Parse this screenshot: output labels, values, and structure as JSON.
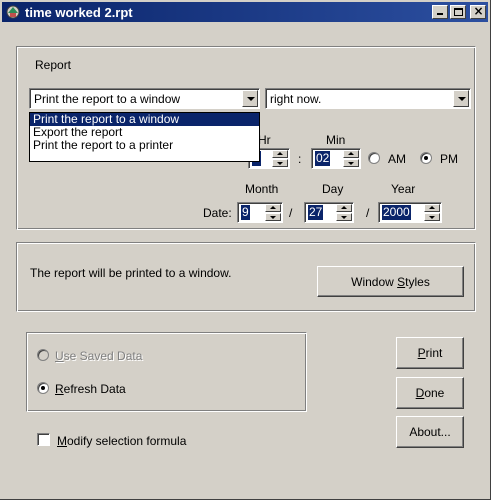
{
  "window": {
    "title": "time worked 2.rpt"
  },
  "report": {
    "group_label": "Report",
    "destination_selected": "Print the report to a window",
    "destination_options": [
      "Print the report to a window",
      "Export the report",
      "Print the report to a printer"
    ],
    "when_selected": "right now.",
    "hr_label": "Hr",
    "min_label": "Min",
    "hour": "2",
    "minute": "02",
    "colon": ":",
    "am_label": "AM",
    "pm_label": "PM",
    "meridiem_selected": "PM",
    "month_label": "Month",
    "day_label": "Day",
    "year_label": "Year",
    "date_label": "Date:",
    "month": "9",
    "day": "27",
    "year": "2000",
    "slash": "/"
  },
  "status": {
    "message": "The report will be printed to a window.",
    "window_styles_pre": "Window ",
    "window_styles_u": "S",
    "window_styles_post": "tyles"
  },
  "data_source": {
    "use_saved_u": "U",
    "use_saved_rest": "se Saved Data",
    "refresh_u": "R",
    "refresh_rest": "efresh Data",
    "selected": "Refresh Data"
  },
  "modify": {
    "u": "M",
    "rest": "odify selection formula",
    "checked": false
  },
  "buttons": {
    "print_u": "P",
    "print_rest": "rint",
    "done_u": "D",
    "done_rest": "one",
    "about": "About..."
  },
  "colors": {
    "titlebar": "#0a246a",
    "face": "#d4d0c8",
    "highlight": "#0a246a"
  }
}
